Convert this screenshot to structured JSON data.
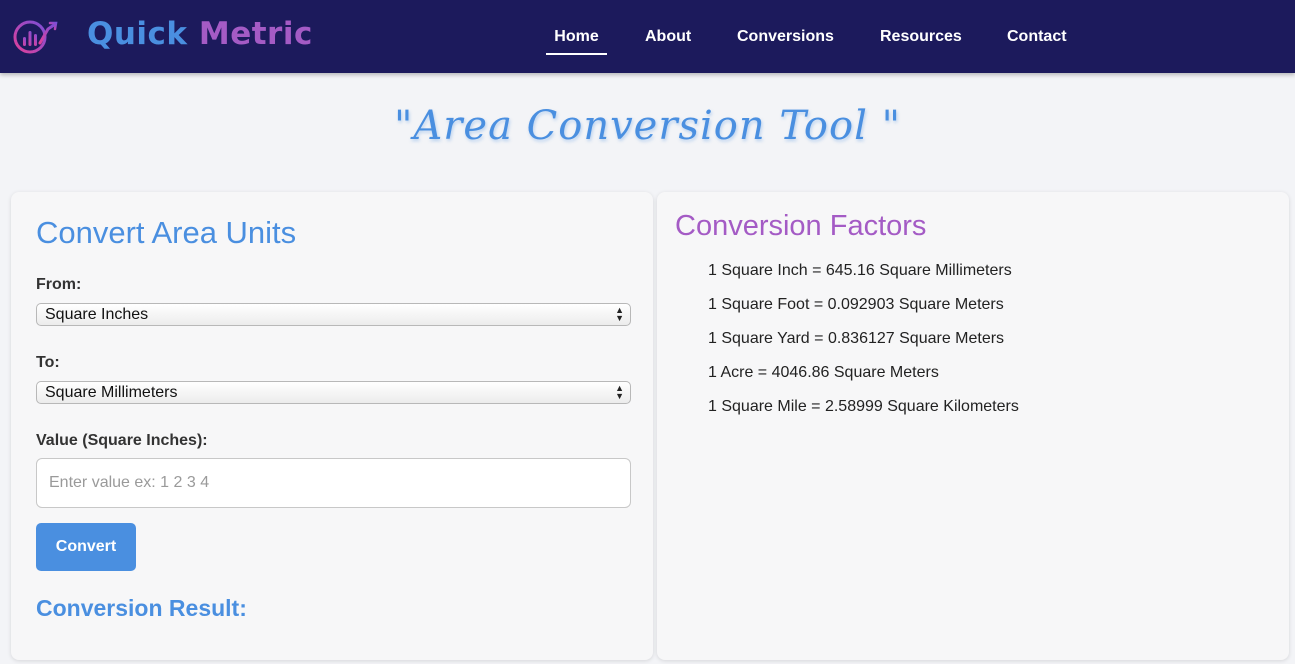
{
  "brand": {
    "word1": "Quick",
    "word2": "Metric"
  },
  "nav": {
    "items": [
      {
        "label": "Home",
        "active": true
      },
      {
        "label": "About",
        "active": false
      },
      {
        "label": "Conversions",
        "active": false
      },
      {
        "label": "Resources",
        "active": false
      },
      {
        "label": "Contact",
        "active": false
      }
    ]
  },
  "page_title": "\"Area Conversion Tool \"",
  "converter": {
    "heading": "Convert Area Units",
    "from_label": "From:",
    "from_value": "Square Inches",
    "to_label": "To:",
    "to_value": "Square Millimeters",
    "value_label": "Value (Square Inches):",
    "value_placeholder": "Enter value ex: 1 2 3 4",
    "value_current": "",
    "convert_label": "Convert",
    "result_heading": "Conversion Result:"
  },
  "factors": {
    "heading": "Conversion Factors",
    "items": [
      "1 Square Inch = 645.16 Square Millimeters",
      "1 Square Foot = 0.092903 Square Meters",
      "1 Square Yard = 0.836127 Square Meters",
      "1 Acre = 4046.86 Square Meters",
      "1 Square Mile = 2.58999 Square Kilometers"
    ]
  },
  "colors": {
    "navbar": "#1c1a5c",
    "accent_blue": "#4a8fe0",
    "accent_purple": "#a45bc5",
    "background": "#f3f4f7"
  },
  "icons": {
    "logo": "bar-chart-arrow-logo-icon"
  }
}
